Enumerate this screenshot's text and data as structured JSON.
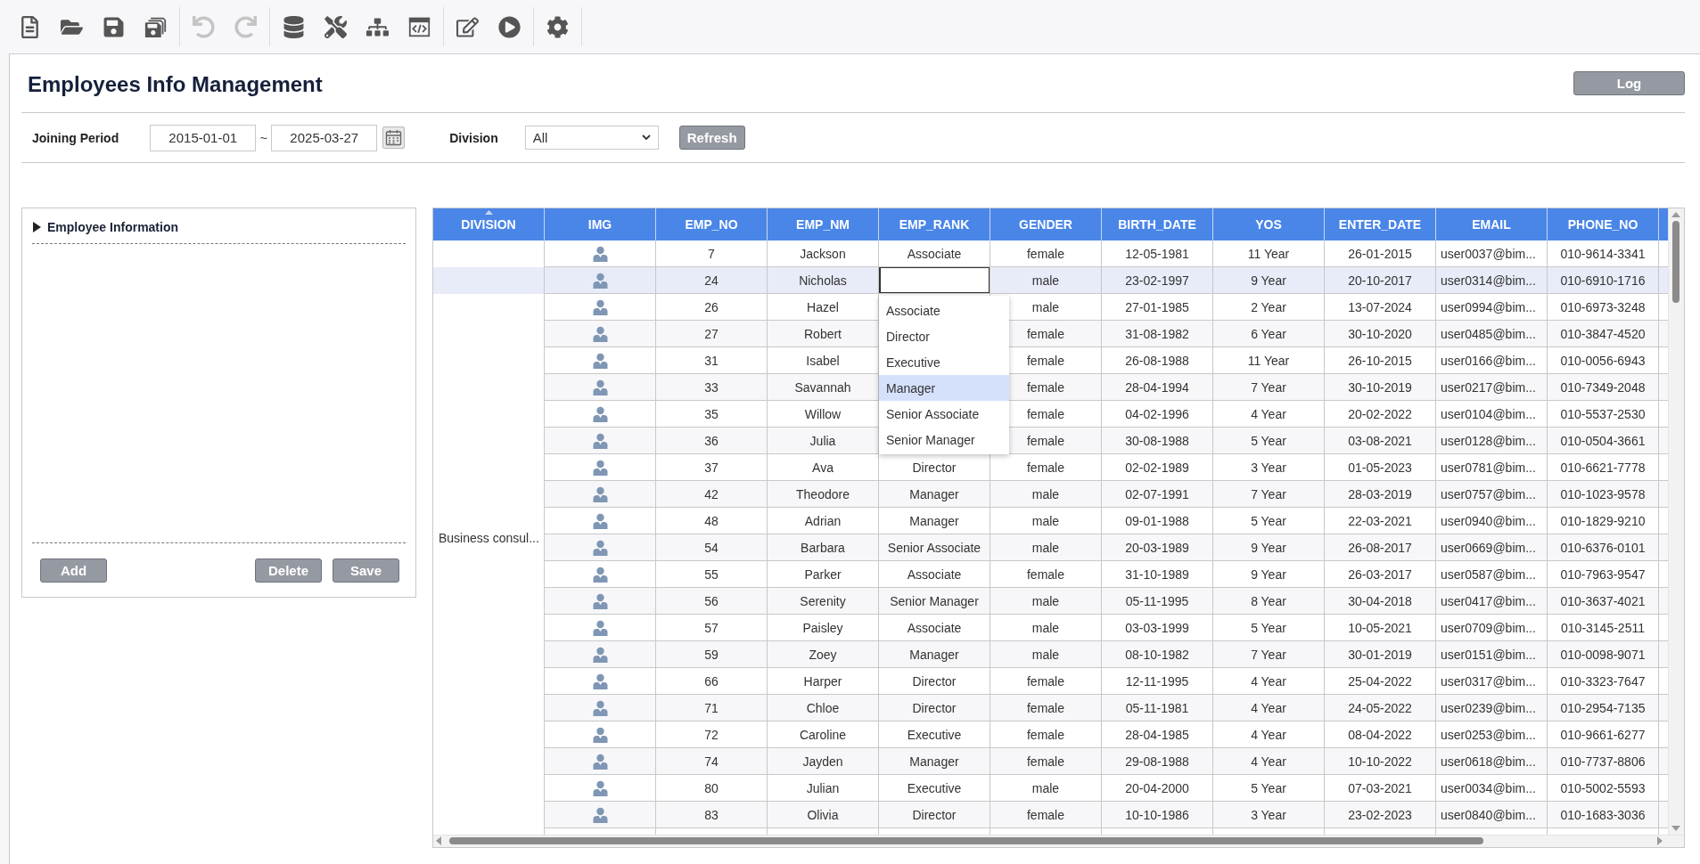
{
  "toolbar": {
    "groups": [
      [
        {
          "disabled": false
        },
        {
          "disabled": false
        },
        {
          "disabled": false
        },
        {
          "disabled": false
        }
      ],
      [
        {
          "disabled": true
        },
        {
          "disabled": true
        }
      ],
      [
        {
          "disabled": false
        },
        {
          "disabled": false
        },
        {
          "disabled": false
        },
        {
          "disabled": false
        }
      ],
      [
        {
          "disabled": false
        },
        {
          "disabled": false
        }
      ],
      [
        {
          "disabled": false
        }
      ]
    ]
  },
  "page": {
    "title": "Employees Info Management",
    "log_button": "Log"
  },
  "filters": {
    "joining_period": {
      "label": "Joining Period",
      "from": "2015-01-01",
      "separator": "~",
      "to": "2025-03-27"
    },
    "division": {
      "label": "Division",
      "value": "All"
    },
    "refresh_button": "Refresh"
  },
  "detail_panel": {
    "title": "Employee Information",
    "expanded": false,
    "buttons": [
      "Add",
      "Delete",
      "Save"
    ]
  },
  "table": {
    "columns": [
      "DIVISION",
      "IMG",
      "EMP_NO",
      "EMP_NM",
      "EMP_RANK",
      "GENDER",
      "BIRTH_DATE",
      "YOS",
      "ENTER_DATE",
      "EMAIL",
      "PHONE_NO"
    ],
    "division_cell": "Business consul...",
    "rows": [
      {
        "selected": false,
        "editing": false,
        "emp_no": "7",
        "emp_nm": "Jackson",
        "emp_rank": "Associate",
        "gender": "female",
        "birth_date": "12-05-1981",
        "yos": "11 Year",
        "enter_date": "26-01-2015",
        "email": "user0037@bim...",
        "phone_no": "010-9614-3341"
      },
      {
        "selected": true,
        "editing": true,
        "emp_no": "24",
        "emp_nm": "Nicholas",
        "gender": "male",
        "birth_date": "23-02-1997",
        "yos": "9 Year",
        "enter_date": "20-10-2017",
        "email": "user0314@bim...",
        "phone_no": "010-6910-1716"
      },
      {
        "selected": false,
        "editing": false,
        "emp_no": "26",
        "emp_nm": "Hazel",
        "gender": "male",
        "birth_date": "27-01-1985",
        "yos": "2 Year",
        "enter_date": "13-07-2024",
        "email": "user0994@bim...",
        "phone_no": "010-6973-3248"
      },
      {
        "selected": false,
        "editing": false,
        "emp_no": "27",
        "emp_nm": "Robert",
        "gender": "female",
        "birth_date": "31-08-1982",
        "yos": "6 Year",
        "enter_date": "30-10-2020",
        "email": "user0485@bim...",
        "phone_no": "010-3847-4520"
      },
      {
        "selected": false,
        "editing": false,
        "emp_no": "31",
        "emp_nm": "Isabel",
        "gender": "female",
        "birth_date": "26-08-1988",
        "yos": "11 Year",
        "enter_date": "26-10-2015",
        "email": "user0166@bim...",
        "phone_no": "010-0056-6943"
      },
      {
        "selected": false,
        "editing": false,
        "emp_no": "33",
        "emp_nm": "Savannah",
        "gender": "female",
        "birth_date": "28-04-1994",
        "yos": "7 Year",
        "enter_date": "30-10-2019",
        "email": "user0217@bim...",
        "phone_no": "010-7349-2048"
      },
      {
        "selected": false,
        "editing": false,
        "emp_no": "35",
        "emp_nm": "Willow",
        "gender": "female",
        "birth_date": "04-02-1996",
        "yos": "4 Year",
        "enter_date": "20-02-2022",
        "email": "user0104@bim...",
        "phone_no": "010-5537-2530"
      },
      {
        "selected": false,
        "editing": false,
        "emp_no": "36",
        "emp_nm": "Julia",
        "gender": "female",
        "birth_date": "30-08-1988",
        "yos": "5 Year",
        "enter_date": "03-08-2021",
        "email": "user0128@bim...",
        "phone_no": "010-0504-3661"
      },
      {
        "selected": false,
        "editing": false,
        "emp_no": "37",
        "emp_nm": "Ava",
        "emp_rank": "Director",
        "gender": "female",
        "birth_date": "02-02-1989",
        "yos": "3 Year",
        "enter_date": "01-05-2023",
        "email": "user0781@bim...",
        "phone_no": "010-6621-7778"
      },
      {
        "selected": false,
        "editing": false,
        "emp_no": "42",
        "emp_nm": "Theodore",
        "emp_rank": "Manager",
        "gender": "male",
        "birth_date": "02-07-1991",
        "yos": "7 Year",
        "enter_date": "28-03-2019",
        "email": "user0757@bim...",
        "phone_no": "010-1023-9578"
      },
      {
        "selected": false,
        "editing": false,
        "emp_no": "48",
        "emp_nm": "Adrian",
        "emp_rank": "Manager",
        "gender": "male",
        "birth_date": "09-01-1988",
        "yos": "5 Year",
        "enter_date": "22-03-2021",
        "email": "user0940@bim...",
        "phone_no": "010-1829-9210"
      },
      {
        "selected": false,
        "editing": false,
        "emp_no": "54",
        "emp_nm": "Barbara",
        "emp_rank": "Senior Associate",
        "gender": "male",
        "birth_date": "20-03-1989",
        "yos": "9 Year",
        "enter_date": "26-08-2017",
        "email": "user0669@bim...",
        "phone_no": "010-6376-0101"
      },
      {
        "selected": false,
        "editing": false,
        "emp_no": "55",
        "emp_nm": "Parker",
        "emp_rank": "Associate",
        "gender": "female",
        "birth_date": "31-10-1989",
        "yos": "9 Year",
        "enter_date": "26-03-2017",
        "email": "user0587@bim...",
        "phone_no": "010-7963-9547"
      },
      {
        "selected": false,
        "editing": false,
        "emp_no": "56",
        "emp_nm": "Serenity",
        "emp_rank": "Senior Manager",
        "gender": "male",
        "birth_date": "05-11-1995",
        "yos": "8 Year",
        "enter_date": "30-04-2018",
        "email": "user0417@bim...",
        "phone_no": "010-3637-4021"
      },
      {
        "selected": false,
        "editing": false,
        "emp_no": "57",
        "emp_nm": "Paisley",
        "emp_rank": "Associate",
        "gender": "male",
        "birth_date": "03-03-1999",
        "yos": "5 Year",
        "enter_date": "10-05-2021",
        "email": "user0709@bim...",
        "phone_no": "010-3145-2511"
      },
      {
        "selected": false,
        "editing": false,
        "emp_no": "59",
        "emp_nm": "Zoey",
        "emp_rank": "Manager",
        "gender": "male",
        "birth_date": "08-10-1982",
        "yos": "7 Year",
        "enter_date": "30-01-2019",
        "email": "user0151@bim...",
        "phone_no": "010-0098-9071"
      },
      {
        "selected": false,
        "editing": false,
        "emp_no": "66",
        "emp_nm": "Harper",
        "emp_rank": "Director",
        "gender": "female",
        "birth_date": "12-11-1995",
        "yos": "4 Year",
        "enter_date": "25-04-2022",
        "email": "user0317@bim...",
        "phone_no": "010-3323-7647"
      },
      {
        "selected": false,
        "editing": false,
        "emp_no": "71",
        "emp_nm": "Chloe",
        "emp_rank": "Director",
        "gender": "female",
        "birth_date": "05-11-1981",
        "yos": "4 Year",
        "enter_date": "24-05-2022",
        "email": "user0239@bim...",
        "phone_no": "010-2954-7135"
      },
      {
        "selected": false,
        "editing": false,
        "emp_no": "72",
        "emp_nm": "Caroline",
        "emp_rank": "Executive",
        "gender": "female",
        "birth_date": "28-04-1985",
        "yos": "4 Year",
        "enter_date": "08-04-2022",
        "email": "user0253@bim...",
        "phone_no": "010-9661-6277"
      },
      {
        "selected": false,
        "editing": false,
        "emp_no": "74",
        "emp_nm": "Jayden",
        "emp_rank": "Manager",
        "gender": "female",
        "birth_date": "29-08-1988",
        "yos": "4 Year",
        "enter_date": "10-10-2022",
        "email": "user0618@bim...",
        "phone_no": "010-7737-8806"
      },
      {
        "selected": false,
        "editing": false,
        "emp_no": "80",
        "emp_nm": "Julian",
        "emp_rank": "Executive",
        "gender": "male",
        "birth_date": "20-04-2000",
        "yos": "5 Year",
        "enter_date": "07-03-2021",
        "email": "user0034@bim...",
        "phone_no": "010-5002-5593"
      },
      {
        "selected": false,
        "editing": false,
        "emp_no": "83",
        "emp_nm": "Olivia",
        "emp_rank": "Director",
        "gender": "female",
        "birth_date": "10-10-1986",
        "yos": "3 Year",
        "enter_date": "23-02-2023",
        "email": "user0840@bim...",
        "phone_no": "010-1683-3036"
      }
    ],
    "rank_editor": {
      "options": [
        {
          "label": "Associate",
          "selected": false
        },
        {
          "label": "Director",
          "selected": false
        },
        {
          "label": "Executive",
          "selected": false
        },
        {
          "label": "Manager",
          "selected": true
        },
        {
          "label": "Senior Associate",
          "selected": false
        },
        {
          "label": "Senior Manager",
          "selected": false
        }
      ]
    }
  }
}
